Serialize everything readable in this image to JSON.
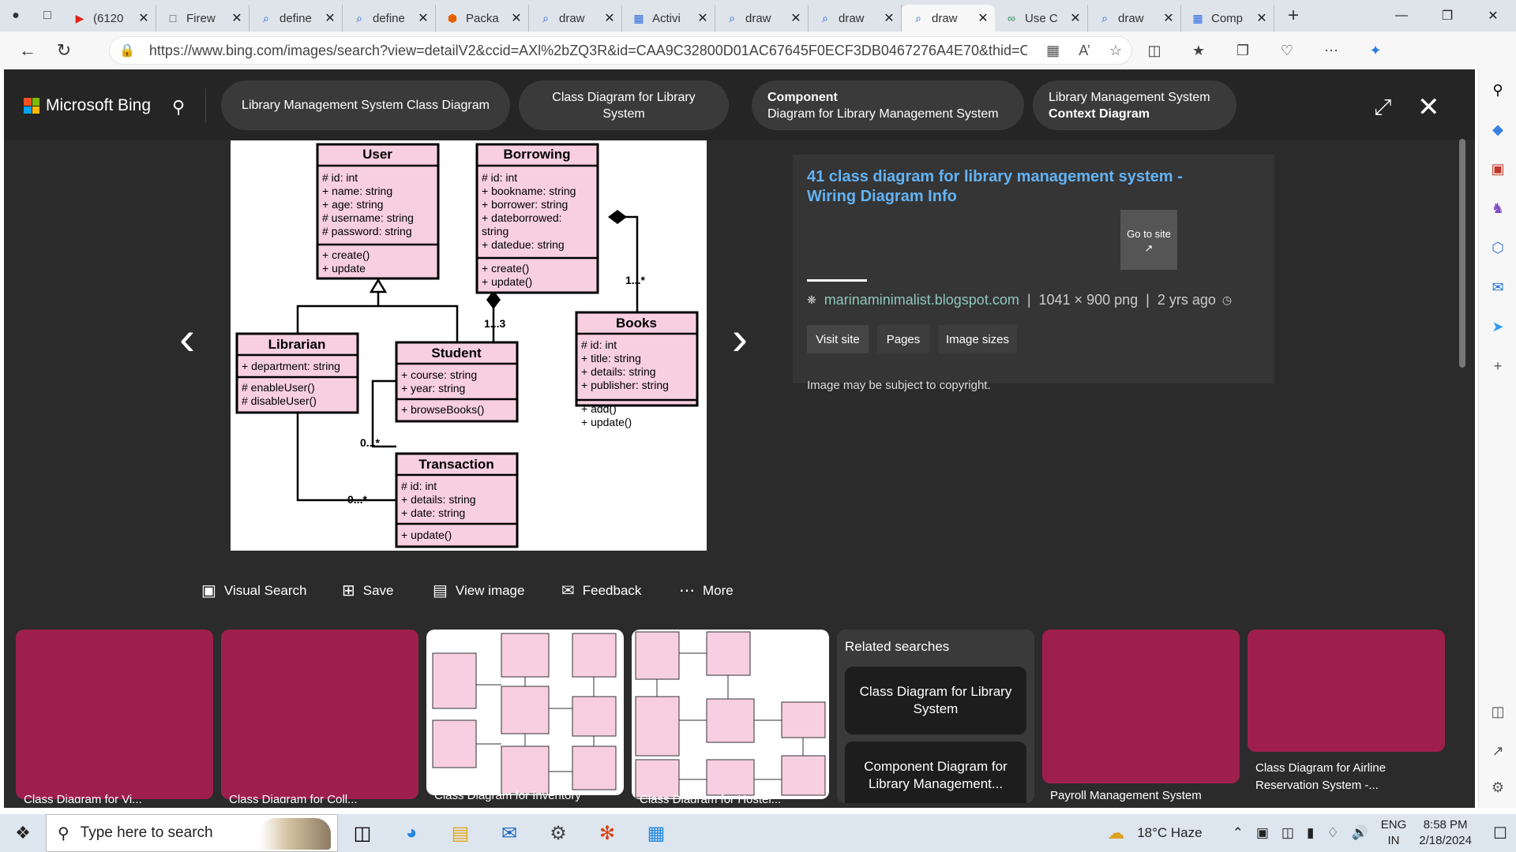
{
  "browser": {
    "tabs": [
      {
        "title": "(6120",
        "icon": "youtube-icon",
        "color": "#e62117"
      },
      {
        "title": "Firew",
        "icon": "page-icon",
        "color": "#444"
      },
      {
        "title": "define",
        "icon": "bing-search-icon",
        "color": "#1a5ed6"
      },
      {
        "title": "define",
        "icon": "bing-search-icon",
        "color": "#1a5ed6"
      },
      {
        "title": "Packa",
        "icon": "package-icon",
        "color": "#e66000"
      },
      {
        "title": "draw",
        "icon": "bing-search-icon",
        "color": "#1a5ed6"
      },
      {
        "title": "Activi",
        "icon": "diagram-icon",
        "color": "#2d6cdf"
      },
      {
        "title": "draw",
        "icon": "bing-search-icon",
        "color": "#1a5ed6"
      },
      {
        "title": "draw",
        "icon": "bing-search-icon",
        "color": "#1a5ed6"
      },
      {
        "title": "draw",
        "icon": "bing-search-icon",
        "color": "#1a5ed6"
      },
      {
        "title": "Use C",
        "icon": "link-icon",
        "color": "#2e8b57"
      },
      {
        "title": "draw",
        "icon": "bing-search-icon",
        "color": "#1a5ed6"
      },
      {
        "title": "Comp",
        "icon": "diagram-icon",
        "color": "#2d6cdf"
      }
    ],
    "url": "https://www.bing.com/images/search?view=detailV2&ccid=AXl%2bZQ3R&id=CAA9C32800D01AC67645F0ECF3DB0467276A4E70&thid=OIP.AXl-ZQ3RazOHUk..."
  },
  "viewer": {
    "brand": "Microsoft Bing",
    "pills": [
      {
        "line1": "Library Management System Class Diagram",
        "line2": ""
      },
      {
        "line1": "Class Diagram for Library System",
        "line2": ""
      },
      {
        "line1": "Component",
        "line2": "Diagram for Library Management System"
      },
      {
        "line1": "Library Management System",
        "line2": "Context Diagram"
      }
    ],
    "info": {
      "title": "41 class diagram for library management system - Wiring Diagram Info",
      "goto": "Go to site",
      "domain": "marinaminimalist.blogspot.com",
      "dims": "1041 × 900 png",
      "age": "2 yrs ago",
      "buttons": [
        "Visit site",
        "Pages",
        "Image sizes"
      ],
      "copyright": "Image may be subject to copyright."
    },
    "toolbar": [
      "Visual Search",
      "Save",
      "View image",
      "Feedback",
      "More"
    ],
    "thumbs": [
      {
        "caption": "Class Diagram for Vi..."
      },
      {
        "caption": "Class Diagram for Coll..."
      },
      {
        "caption": "Class Diagram for Inventory"
      },
      {
        "caption": "Class Diagram for Hostel..."
      }
    ],
    "related": {
      "heading": "Related searches",
      "items": [
        "Class Diagram for Library System",
        "Component Diagram for Library Management..."
      ]
    },
    "thumbs2": [
      {
        "caption": "Payroll Management System"
      },
      {
        "caption": "Class Diagram for Airline Reservation System -..."
      }
    ]
  },
  "diagram": {
    "user": {
      "name": "User",
      "attrs": [
        "# id: int",
        "+ name: string",
        "+ age: string",
        "# username: string",
        "# password: string"
      ],
      "ops": [
        "+ create()",
        "+ update"
      ]
    },
    "borrowing": {
      "name": "Borrowing",
      "attrs": [
        "# id: int",
        "+ bookname: string",
        "+ borrower: string",
        "+ dateborrowed:",
        "string",
        "+ datedue: string"
      ],
      "ops": [
        "+ create()",
        "+ update()"
      ]
    },
    "librarian": {
      "name": "Librarian",
      "attrs": [
        "+ department: string"
      ],
      "ops": [
        "# enableUser()",
        "# disableUser()"
      ]
    },
    "student": {
      "name": "Student",
      "attrs": [
        "+ course: string",
        "+ year: string"
      ],
      "ops": [
        "+ browseBooks()"
      ]
    },
    "books": {
      "name": "Books",
      "attrs": [
        "# id: int",
        "+ title: string",
        "+ details: string",
        "+ publisher: string"
      ],
      "ops": [
        "+ add()",
        "+ update()"
      ]
    },
    "transaction": {
      "name": "Transaction",
      "attrs": [
        "# id: int",
        "+ details: string",
        "+ date: string"
      ],
      "ops": [
        "+ update()"
      ]
    },
    "mult": {
      "m13": "1...3",
      "m1n": "1...*",
      "m0n_a": "0...*",
      "m0n_b": "0...*"
    }
  },
  "taskbar": {
    "search_placeholder": "Type here to search",
    "weather": "18°C  Haze",
    "lang": "ENG",
    "region": "IN",
    "time": "8:58 PM",
    "date": "2/18/2024"
  },
  "colors": {
    "accent": "#63b3f5",
    "umlFill": "#f7cfe0",
    "thumbFill": "#9e1f4c"
  }
}
